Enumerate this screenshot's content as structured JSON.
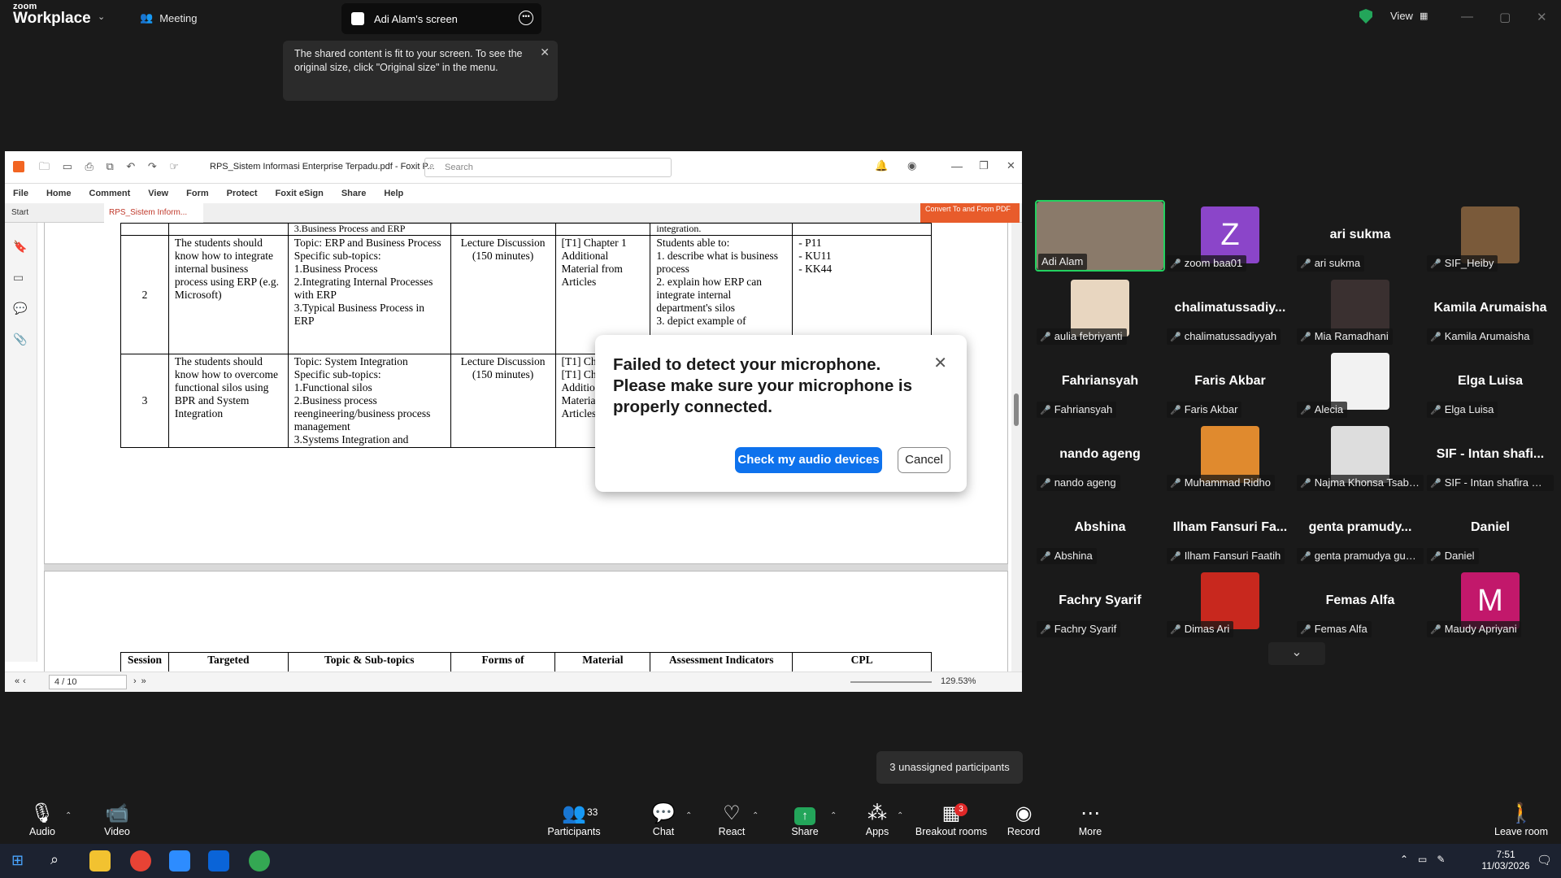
{
  "app": {
    "brand_top": "zoom",
    "brand_bottom": "Workplace",
    "meeting_label": "Meeting",
    "screen_tab": "Adi Alam's screen",
    "view_label": "View"
  },
  "tooltip": {
    "text": "The shared content is fit to your screen. To see the original size, click \"Original size\" in the menu."
  },
  "foxit": {
    "title": "RPS_Sistem Informasi Enterprise Terpadu.pdf - Foxit P...",
    "search_placeholder": "Search",
    "menu": [
      "File",
      "Home",
      "Comment",
      "View",
      "Form",
      "Protect",
      "Foxit eSign",
      "Share",
      "Help"
    ],
    "tabs": [
      "Start",
      "RPS_Sistem Inform..."
    ],
    "convert": "Convert To and From PDF",
    "page": "4 / 10",
    "zoom": "129.53%"
  },
  "doc": {
    "row0": {
      "topic": "3.Business Process and ERP",
      "indicator": "integration."
    },
    "row2": {
      "session": "2",
      "targeted": "The students should know how to integrate internal business process using ERP (e.g. Microsoft)",
      "topic": "Topic: ERP and Business Process\nSpecific sub-topics:\n1.Business Process\n2.Integrating Internal Processes with ERP\n3.Typical Business Process in ERP",
      "forms": "Lecture Discussion (150 minutes)",
      "material": "[T1] Chapter 1 Additional Material from Articles",
      "indicator": "Students able to:\n1. describe what is business process\n2. explain how ERP can integrate internal department's silos\n3. depict example of",
      "cpl": "- P11\n- KU11\n- KK44"
    },
    "row3": {
      "session": "3",
      "targeted": "The students should know how to overcome functional silos using BPR and System Integration",
      "topic": "Topic: System Integration\nSpecific sub-topics:\n1.Functional silos\n2.Business process reengineering/business process management\n3.Systems Integration and",
      "forms": "Lecture Discussion (150 minutes)",
      "material": "[T1] Ch\n[T1] Ch\nAdditio\nMateria\nArticles"
    },
    "header": [
      "Session",
      "Targeted",
      "Topic & Sub-topics",
      "Forms of",
      "Material",
      "Assessment Indicators",
      "CPL"
    ]
  },
  "dialog": {
    "message": "Failed to detect your microphone. Please make sure your microphone is properly connected.",
    "primary": "Check my audio devices",
    "secondary": "Cancel"
  },
  "gallery": [
    {
      "name": "",
      "label": "Adi Alam",
      "muted": false,
      "pic": "#8a7a6a",
      "active": true
    },
    {
      "name": "",
      "label": "zoom baa01",
      "muted": true,
      "pic": "#8b45c9",
      "letter": "Z"
    },
    {
      "name": "ari sukma",
      "label": "ari sukma",
      "muted": true
    },
    {
      "name": "",
      "label": "SIF_Heiby",
      "muted": true,
      "pic": "#7a5a3a"
    },
    {
      "name": "",
      "label": "aulia febriyanti",
      "muted": true,
      "pic": "#e8d6c0"
    },
    {
      "name": "chalimatussadiy...",
      "label": "chalimatussadiyyah",
      "muted": true
    },
    {
      "name": "",
      "label": "Mia Ramadhani",
      "muted": true,
      "pic": "#3a3030"
    },
    {
      "name": "Kamila Arumaisha",
      "label": "Kamila Arumaisha",
      "muted": true
    },
    {
      "name": "Fahriansyah",
      "label": "Fahriansyah",
      "muted": true
    },
    {
      "name": "Faris Akbar",
      "label": "Faris Akbar",
      "muted": true
    },
    {
      "name": "",
      "label": "Alecia",
      "muted": true,
      "pic": "#f2f2f2"
    },
    {
      "name": "Elga Luisa",
      "label": "Elga Luisa",
      "muted": true
    },
    {
      "name": "nando ageng",
      "label": "nando ageng",
      "muted": true
    },
    {
      "name": "",
      "label": "Muhammad Ridho",
      "muted": true,
      "pic": "#e08a2e"
    },
    {
      "name": "",
      "label": "Najma Khonsa Tsabita",
      "muted": true,
      "pic": "#ddd"
    },
    {
      "name": "SIF - Intan shafi...",
      "label": "SIF - Intan shafira Rah...",
      "muted": true
    },
    {
      "name": "Abshina",
      "label": "Abshina",
      "muted": true
    },
    {
      "name": "Ilham Fansuri Fa...",
      "label": "Ilham Fansuri Faatih",
      "muted": true
    },
    {
      "name": "genta  pramudy...",
      "label": "genta pramudya gun...",
      "muted": true
    },
    {
      "name": "Daniel",
      "label": "Daniel",
      "muted": true
    },
    {
      "name": "Fachry Syarif",
      "label": "Fachry Syarif",
      "muted": true
    },
    {
      "name": "",
      "label": "Dimas Ari",
      "muted": true,
      "pic": "#c8281e"
    },
    {
      "name": "Femas Alfa",
      "label": "Femas Alfa",
      "muted": true
    },
    {
      "name": "",
      "label": "Maudy Apriyani",
      "muted": true,
      "pic": "#c2186b",
      "letter": "M"
    }
  ],
  "toolbar": {
    "audio": "Audio",
    "video": "Video",
    "participants": "Participants",
    "participants_count": "33",
    "chat": "Chat",
    "react": "React",
    "share": "Share",
    "apps": "Apps",
    "breakout": "Breakout rooms",
    "breakout_badge": "3",
    "record": "Record",
    "more": "More",
    "leave": "Leave room",
    "unassigned": "3 unassigned participants"
  },
  "taskbar": {
    "time": "7:51",
    "date": "11/03/2026"
  },
  "colors": {
    "accent": "#0e72ed",
    "active_border": "#23d160",
    "muted": "#e02828"
  }
}
